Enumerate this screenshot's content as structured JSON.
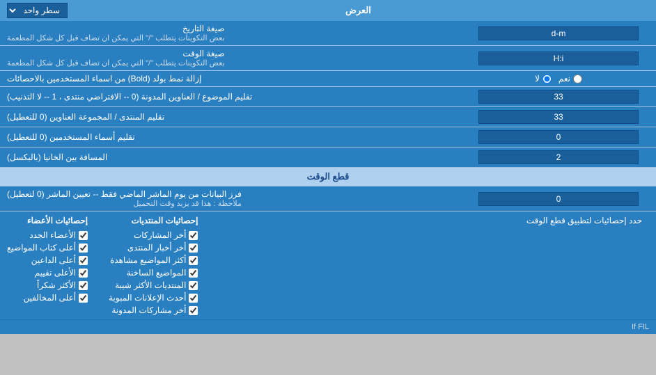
{
  "header": {
    "label": "العرض",
    "dropdown_label": "سطر واحد",
    "dropdown_icon": "▼"
  },
  "rows": [
    {
      "id": "date_format",
      "right_text": "صيغة التاريخ",
      "right_sub": "بعض التكوينات يتطلب \"/\" التي يمكن ان تضاف قبل كل شكل المطعمة",
      "left_value": "d-m",
      "left_type": "text"
    },
    {
      "id": "time_format",
      "right_text": "صيغة الوقت",
      "right_sub": "بعض التكوينات يتطلب \"/\" التي يمكن ان تضاف قبل كل شكل المطعمة",
      "left_value": "H:i",
      "left_type": "text"
    },
    {
      "id": "bold_remove",
      "right_text": "إزالة نمط بولد (Bold) من اسماء المستخدمين بالاحصائات",
      "left_type": "radio",
      "radio_yes": "نعم",
      "radio_no": "لا",
      "radio_selected": "no"
    },
    {
      "id": "topics_per_page",
      "right_text": "تقليم الموضوع / العناوين المدونة (0 -- الافتراضي منتدى ، 1 -- لا التذنيب)",
      "left_value": "33",
      "left_type": "number"
    },
    {
      "id": "forum_per_page",
      "right_text": "تقليم المنتدى / المجموعة العناوين (0 للتعطيل)",
      "left_value": "33",
      "left_type": "number"
    },
    {
      "id": "users_per_page",
      "right_text": "تقليم أسماء المستخدمين (0 للتعطيل)",
      "left_value": "0",
      "left_type": "number"
    },
    {
      "id": "spacing",
      "right_text": "المسافة بين الخانيا (بالبكسل)",
      "left_value": "2",
      "left_type": "number"
    }
  ],
  "time_section": {
    "title": "قطع الوقت",
    "row": {
      "right_text": "فرز البيانات من يوم الماشر الماضي فقط -- تعيين الماشر (0 لتعطيل)",
      "right_note": "ملاحظة : هذا قد يزيد وقت التحميل",
      "left_value": "0",
      "left_type": "number"
    },
    "limit_label": "حدد إحصائيات لتطبيق قطع الوقت"
  },
  "checkboxes": {
    "col1": {
      "header": "إحصائيات المنتديات",
      "items": [
        "أخر المشاركات",
        "أخر أخبار المنتدى",
        "أكثر المواضيع مشاهدة",
        "المواضيع الساخنة",
        "المنتديات الأكثر شيبة",
        "أحدث الإعلانات المبوبة",
        "أخر مشاركات المدونة"
      ]
    },
    "col2": {
      "header": "إحصائيات الأعضاء",
      "items": [
        "الأعضاء الجدد",
        "أعلى كتاب المواضيع",
        "أعلى الداعين",
        "الأعلى تقييم",
        "الأكثر شكراً",
        "أعلى المخالفين"
      ]
    }
  }
}
